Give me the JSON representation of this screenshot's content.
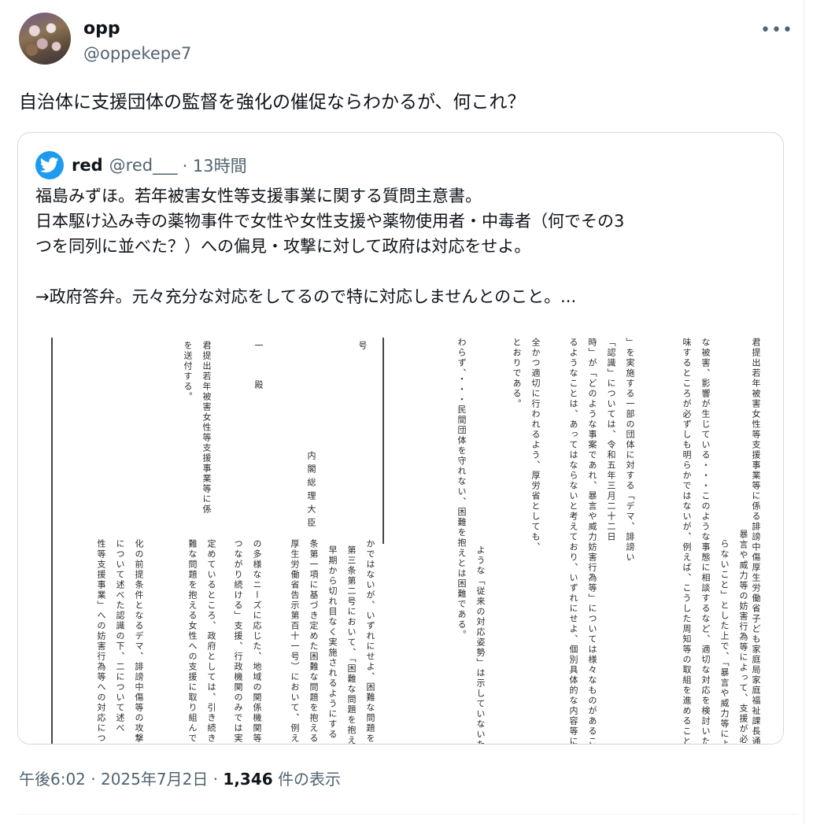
{
  "author": {
    "display_name": "opp",
    "handle": "@oppekepe7"
  },
  "tweet": {
    "text": "自治体に支援団体の監督を強化の催促ならわかるが、何これ？"
  },
  "quote": {
    "name": "red",
    "handle": "@red___",
    "time": "· 13時間",
    "lines": [
      "福島みずほ。若年被害女性等支援事業に関する質問主意書。",
      "日本駆け込み寺の薬物事件で女性や女性支援や薬物使用者・中毒者（何でその3",
      "つを同列に並べた？）への偏見・攻撃に対して政府は対応をせよ。",
      "",
      "→政府答弁。元々充分な対応をしてるので特に対応しませんとのこと。..."
    ]
  },
  "document_columns": [
    "君提出若年被害女性等支援事業等に係る誹謗中傷厚生労働省子ども家庭局家庭福祉課長通知」に",
    "暴言や威力等の妨害行為等によって、支援が必",
    "らないこと」とした上で、「暴言や威力等によ",
    "な被害、影響が生じている・・・このような事態に相談するなど、適切な対応を検討いただ",
    "味するところが必ずしも明らかではないが、例えば、こうした周知等の取組を進めることにより",
    "」を実施する一部の団体に対する「デマ、誹謗い",
    "「認識」については、令和五年三月二十二日",
    "時」が「どのような事案であれ、暴言や威力妨害行為等」については様々なものがあることから、",
    "るようなことは、あってはならないと考えており、いずれにせよ、個別具体的な内容等に応じ、適切",
    "全かつ適切に行われるよう、厚労省としても、",
    "とおりである。",
    "ような「従来の対応姿勢」は示していないため",
    "わらず、・・・民間団体を守れない、困難を抱えとは困難である。",
    "かではないが、いずれにせよ、困難な問題を抱",
    "第三条第二号において、「困難な問題を抱え",
    "早期から切れ目なく実施されるようにする",
    "条第一項に基づき定めた困難な問題を抱える女",
    "厚生労働省告示第百十一号）において、例えば",
    "の多様なニーズに応じた、地域の関係機関等の",
    "つながり続ける」支援、行政機関のみでは実施",
    "定めているところ、政府としては、引き続き、",
    "難な問題を抱える女性への支援に取り組んでま",
    "化の前提条件となるデマ、誹謗中傷等の攻撃の",
    "について述べた認識の下、二について述べ",
    "性等支援事業」への妨害行為等への対応につい",
    "内閣総理大臣",
    "号",
    "一　殿",
    "君提出若年被害女性等支援事業等に係",
    "を送付する。"
  ],
  "meta": {
    "time": "午後6:02 · 2025年7月2日 · ",
    "views_count": "1,346",
    "views_label": " 件の表示"
  }
}
